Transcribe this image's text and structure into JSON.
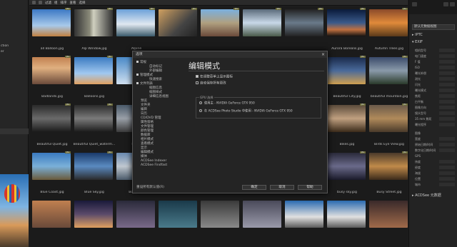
{
  "left_panel": {
    "items": [
      "",
      "",
      "",
      "",
      "",
      "",
      "",
      "",
      "",
      "",
      "ction",
      "er"
    ]
  },
  "toolbar": {
    "breadcrumbs": [
      "过滤",
      "组",
      "排序",
      "查看",
      "选择"
    ]
  },
  "thumbnails": [
    {
      "caption": "all Balloon.jpg",
      "badge": "JPG"
    },
    {
      "caption": "Alp Window.jpg",
      "badge": "JPG"
    },
    {
      "caption": "Alpine",
      "badge": "JPG"
    },
    {
      "caption": "",
      "badge": "JPG"
    },
    {
      "caption": "",
      "badge": "JPG"
    },
    {
      "caption": "",
      "badge": "JPG"
    },
    {
      "caption": "",
      "badge": "JPG"
    },
    {
      "caption": "Aurora Borealis.jpg",
      "badge": "JPG"
    },
    {
      "caption": "Autumn Trees.jpg",
      "badge": "JPG"
    },
    {
      "caption": "Badlands.jpg",
      "badge": "JPG"
    },
    {
      "caption": "Balloons.jpg",
      "badge": "JPG"
    },
    {
      "caption": "Bea",
      "badge": "JPG"
    },
    {
      "caption": "Beautiful City.jpg",
      "badge": "JPG"
    },
    {
      "caption": "beautiful mountain.jpg",
      "badge": "JPG"
    },
    {
      "caption": "Beautiful Quiet.jpg",
      "badge": "JPG"
    },
    {
      "caption": "Beautiful Quiet_waterm...",
      "badge": "JPG"
    },
    {
      "caption": "Berlin",
      "badge": "JPG"
    },
    {
      "caption": "Bikes.jpg",
      "badge": "JPG"
    },
    {
      "caption": "Birds Eye View.jpg",
      "badge": "JPG"
    },
    {
      "caption": "Blue Coast.jpg",
      "badge": "JPG"
    },
    {
      "caption": "Blue Sky.jpg",
      "badge": "JPG"
    },
    {
      "caption": "Boats.jpg",
      "badge": "JPG"
    },
    {
      "caption": "Borneo.jpg",
      "badge": "JPG"
    },
    {
      "caption": "bright field.jpg",
      "badge": "JPG"
    },
    {
      "caption": "Bright Plains.jpg",
      "badge": "JPG"
    },
    {
      "caption": "bustle city.jpg",
      "badge": "JPG"
    },
    {
      "caption": "busy sky.jpg",
      "badge": "JPG"
    },
    {
      "caption": "Busy Street.jpg",
      "badge": "JPG"
    },
    {
      "caption": "",
      "badge": ""
    },
    {
      "caption": "",
      "badge": ""
    },
    {
      "caption": "",
      "badge": ""
    },
    {
      "caption": "",
      "badge": ""
    },
    {
      "caption": "",
      "badge": ""
    },
    {
      "caption": "",
      "badge": ""
    },
    {
      "caption": "",
      "badge": ""
    },
    {
      "caption": "",
      "badge": ""
    },
    {
      "caption": "",
      "badge": ""
    }
  ],
  "right_panel": {
    "select_value": "默认元数据视图",
    "sections": {
      "iptc": "IPTC",
      "exif": "EXIF",
      "acdsee": "ACDSee 元数据"
    },
    "exif_fields": [
      "相机型号",
      "电门速度",
      "F 值",
      "ISO",
      "曝光补偿",
      "测光",
      "闪光",
      "曝光模式",
      "焦距",
      "白平衡",
      "图像方向",
      "镜头型号",
      "35 mm 焦距",
      "曝光程序"
    ],
    "extra_fields": [
      "图像",
      "宽度",
      "原始日期/时间",
      "数字化日期/时间",
      "GPS",
      "纬度",
      "经度",
      "海拔",
      "位置",
      "城市"
    ]
  },
  "dialog": {
    "title": "选项",
    "close_label": "×",
    "heading": "编辑模式",
    "tree": [
      {
        "label": "常规",
        "indent": 0,
        "box": true
      },
      {
        "label": "自动标记",
        "indent": 1,
        "box": false
      },
      {
        "label": "外部编辑",
        "indent": 1,
        "box": false
      },
      {
        "label": "管理模式",
        "indent": 0,
        "box": true
      },
      {
        "label": "快速搜索",
        "indent": 1,
        "box": false
      },
      {
        "label": "文件列表",
        "indent": 0,
        "box": true
      },
      {
        "label": "缩图信息",
        "indent": 1,
        "box": false
      },
      {
        "label": "缩图样式",
        "indent": 1,
        "box": false
      },
      {
        "label": "详细信息视图",
        "indent": 1,
        "box": false
      },
      {
        "label": "预览",
        "indent": 0,
        "box": false
      },
      {
        "label": "文件夹",
        "indent": 0,
        "box": false
      },
      {
        "label": "编目",
        "indent": 0,
        "box": false
      },
      {
        "label": "日历",
        "indent": 0,
        "box": false
      },
      {
        "label": "CD/DVD 管理",
        "indent": 0,
        "box": false
      },
      {
        "label": "属性窗格",
        "indent": 0,
        "box": false
      },
      {
        "label": "文件管理",
        "indent": 0,
        "box": false
      },
      {
        "label": "颜色管理",
        "indent": 0,
        "box": false
      },
      {
        "label": "数据库",
        "indent": 0,
        "box": false
      },
      {
        "label": "相片模式",
        "indent": 0,
        "box": false
      },
      {
        "label": "查看模式",
        "indent": 0,
        "box": false
      },
      {
        "label": "显示",
        "indent": 0,
        "box": false
      },
      {
        "label": "编辑模式",
        "indent": 0,
        "box": false
      },
      {
        "label": "媒体",
        "indent": 0,
        "box": false
      },
      {
        "label": "ACDSee Indexer",
        "indent": 0,
        "box": false
      },
      {
        "label": "ACDSee Findfast",
        "indent": 0,
        "box": false
      }
    ],
    "checkboxes": [
      {
        "label": "在调整菜单上显示图标",
        "checked": true
      },
      {
        "label": "自动保存所有更改",
        "checked": false
      }
    ],
    "gpu_legend": "GPU 选择",
    "gpu_options": [
      {
        "label": "使用主 - NVIDIA GeForce GTX 950",
        "selected": false
      },
      {
        "label": "在 ACDSee Photo Studio 中使用 - NVIDIA GeForce GTX 950",
        "selected": false
      }
    ],
    "reset_label": "重设所有默认值(R)",
    "ok_label": "确定",
    "cancel_label": "取消",
    "help_label": "帮助"
  }
}
